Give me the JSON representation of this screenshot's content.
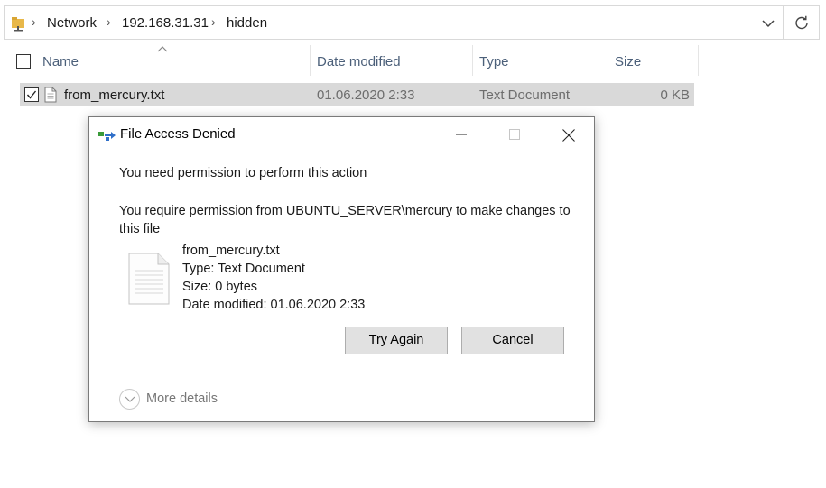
{
  "address_bar": {
    "breadcrumbs": [
      "Network",
      "192.168.31.31",
      "hidden"
    ],
    "icons": {
      "folder": "network-folder-icon",
      "dropdown": "chevron-down-icon",
      "refresh": "refresh-icon"
    }
  },
  "columns": {
    "name": "Name",
    "date_modified": "Date modified",
    "type": "Type",
    "size": "Size"
  },
  "files": [
    {
      "name": "from_mercury.txt",
      "date_modified": "01.06.2020 2:33",
      "type": "Text Document",
      "size": "0 KB",
      "checked": true
    }
  ],
  "dialog": {
    "title": "File Access Denied",
    "heading": "You need permission to perform this action",
    "description": "You require permission from UBUNTU_SERVER\\mercury to make changes to this file",
    "file": {
      "name": "from_mercury.txt",
      "type": "Type: Text Document",
      "size": "Size: 0 bytes",
      "date_modified": "Date modified: 01.06.2020 2:33"
    },
    "buttons": {
      "try_again": "Try Again",
      "cancel": "Cancel"
    },
    "more_details": "More details"
  },
  "colors": {
    "selected_row": "#d9d9d9",
    "header_text": "#4c607a",
    "muted_text": "#6d6d6d",
    "button_bg": "#e1e1e1"
  }
}
